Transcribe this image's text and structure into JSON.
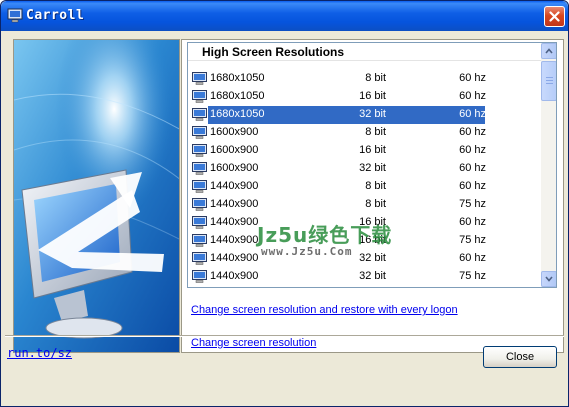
{
  "window": {
    "title": "Carroll"
  },
  "list": {
    "header": "High Screen Resolutions",
    "rows": [
      {
        "resolution": "1680x1050",
        "bits": "8 bit",
        "hz": "60 hz",
        "selected": false
      },
      {
        "resolution": "1680x1050",
        "bits": "16 bit",
        "hz": "60 hz",
        "selected": false
      },
      {
        "resolution": "1680x1050",
        "bits": "32 bit",
        "hz": "60 hz",
        "selected": true
      },
      {
        "resolution": "1600x900",
        "bits": "8 bit",
        "hz": "60 hz",
        "selected": false
      },
      {
        "resolution": "1600x900",
        "bits": "16 bit",
        "hz": "60 hz",
        "selected": false
      },
      {
        "resolution": "1600x900",
        "bits": "32 bit",
        "hz": "60 hz",
        "selected": false
      },
      {
        "resolution": "1440x900",
        "bits": "8 bit",
        "hz": "60 hz",
        "selected": false
      },
      {
        "resolution": "1440x900",
        "bits": "8 bit",
        "hz": "75 hz",
        "selected": false
      },
      {
        "resolution": "1440x900",
        "bits": "16 bit",
        "hz": "60 hz",
        "selected": false
      },
      {
        "resolution": "1440x900",
        "bits": "16 bit",
        "hz": "75 hz",
        "selected": false
      },
      {
        "resolution": "1440x900",
        "bits": "32 bit",
        "hz": "60 hz",
        "selected": false
      },
      {
        "resolution": "1440x900",
        "bits": "32 bit",
        "hz": "75 hz",
        "selected": false
      }
    ]
  },
  "links": {
    "change_restore": "Change screen resolution and restore with every logon",
    "change": "Change screen resolution"
  },
  "watermark": {
    "line1": "Jz5u绿色下载",
    "line2": "www.Jz5u.Com"
  },
  "footer": {
    "link": "run.to/sz",
    "close_label": "Close"
  },
  "colors": {
    "selection": "#316ac5",
    "titlebar": "#0654dd",
    "link": "#0000ee"
  }
}
